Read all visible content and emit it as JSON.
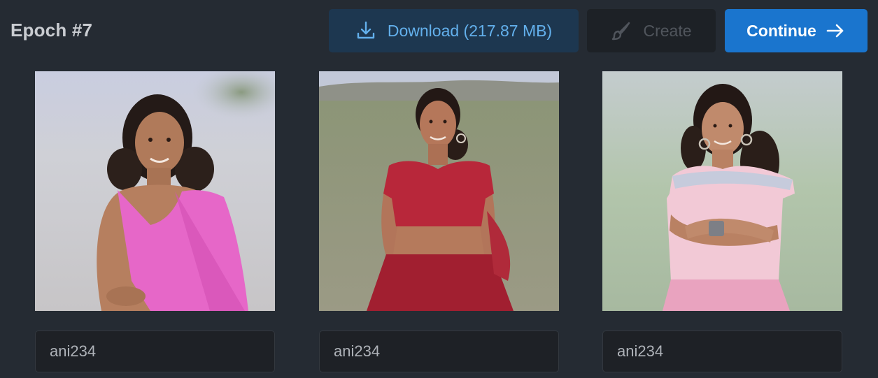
{
  "header": {
    "title": "Epoch #7"
  },
  "toolbar": {
    "download_label": "Download (217.87 MB)",
    "create_label": "Create",
    "continue_label": "Continue",
    "download_icon": "download-icon",
    "create_icon": "brush-icon",
    "continue_icon": "arrow-right-icon"
  },
  "gallery": {
    "items": [
      {
        "caption": "ani234",
        "image": "woman-in-pink-saree"
      },
      {
        "caption": "ani234",
        "image": "woman-in-red-crop-top"
      },
      {
        "caption": "ani234",
        "image": "woman-in-pink-top-arms-crossed"
      }
    ]
  },
  "colors": {
    "background": "#252b33",
    "download_bg": "#1d3750",
    "download_text": "#63b0ec",
    "continue_bg": "#1a75ce",
    "create_bg": "#1d2126"
  }
}
